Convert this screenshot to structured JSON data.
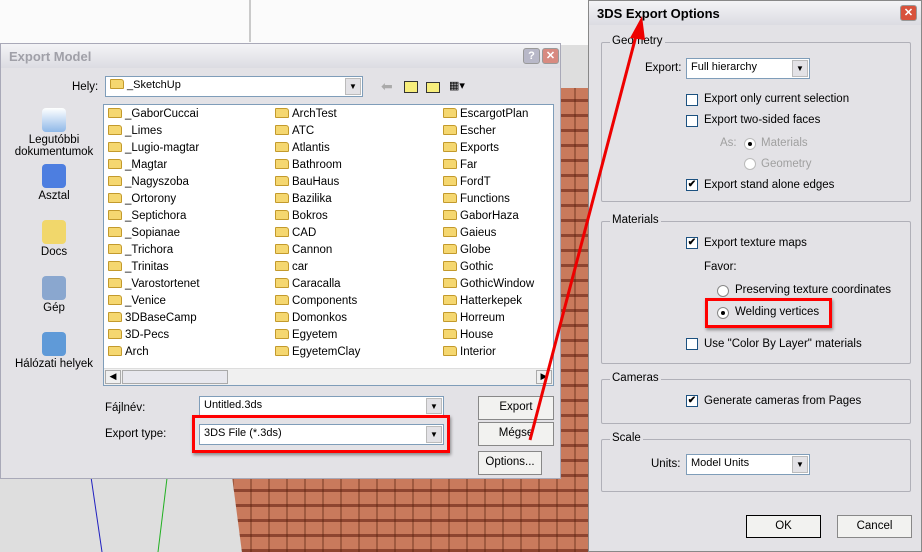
{
  "export_model": {
    "title": "Export Model",
    "help_label": "?",
    "close_label": "✕",
    "location_label": "Hely:",
    "location_value": "_SketchUp",
    "sidebar": [
      {
        "label": "Legutóbbi dokumentumok",
        "icon": "recent-documents-icon"
      },
      {
        "label": "Asztal",
        "icon": "desktop-icon"
      },
      {
        "label": "Docs",
        "icon": "docs-icon"
      },
      {
        "label": "Gép",
        "icon": "computer-icon"
      },
      {
        "label": "Hálózati helyek",
        "icon": "network-places-icon"
      }
    ],
    "files": [
      [
        "_GaborCuccai",
        "_Limes",
        "_Lugio-magtar",
        "_Magtar",
        "_Nagyszoba",
        "_Ortorony",
        "_Septichora",
        "_Sopianae",
        "_Trichora",
        "_Trinitas",
        "_Varostortenet",
        "_Venice",
        "3DBaseCamp",
        "3D-Pecs",
        "Arch"
      ],
      [
        "ArchTest",
        "ATC",
        "Atlantis",
        "Bathroom",
        "BauHaus",
        "Bazilika",
        "Bokros",
        "CAD",
        "Cannon",
        "car",
        "Caracalla",
        "Components",
        "Domonkos",
        "Egyetem",
        "EgyetemClay"
      ],
      [
        "EscargotPlan",
        "Escher",
        "Exports",
        "Far",
        "FordT",
        "Functions",
        "GaborHaza",
        "Gaieus",
        "Globe",
        "Gothic",
        "GothicWindow",
        "Hatterkepek",
        "Horreum",
        "House",
        "Interior"
      ]
    ],
    "filename_label": "Fájlnév:",
    "filename_value": "Untitled.3ds",
    "type_label": "Export type:",
    "type_value": "3DS File (*.3ds)",
    "export_button": "Export",
    "cancel_button": "Mégse",
    "options_button": "Options..."
  },
  "options": {
    "title": "3DS Export Options",
    "geometry": {
      "label": "Geometry",
      "export_label": "Export:",
      "export_value": "Full hierarchy",
      "only_selection": {
        "label": "Export only current selection",
        "checked": false
      },
      "two_sided": {
        "label": "Export two-sided faces",
        "checked": false
      },
      "as_label": "As:",
      "as_materials": {
        "label": "Materials",
        "selected": true
      },
      "as_geometry": {
        "label": "Geometry",
        "selected": false
      },
      "stand_alone": {
        "label": "Export stand alone edges",
        "checked": true
      }
    },
    "materials": {
      "label": "Materials",
      "texture_maps": {
        "label": "Export texture maps",
        "checked": true
      },
      "favor_label": "Favor:",
      "preserve": {
        "label": "Preserving texture coordinates",
        "selected": false
      },
      "welding": {
        "label": "Welding vertices",
        "selected": true
      },
      "color_by_layer": {
        "label": "Use \"Color By Layer\" materials",
        "checked": false
      }
    },
    "cameras": {
      "label": "Cameras",
      "generate": {
        "label": "Generate cameras from Pages",
        "checked": true
      }
    },
    "scale": {
      "label": "Scale",
      "units_label": "Units:",
      "units_value": "Model Units"
    },
    "ok_button": "OK",
    "cancel_button": "Cancel"
  },
  "colors": {
    "highlight": "#ff0000",
    "roof": "#c0704f"
  }
}
